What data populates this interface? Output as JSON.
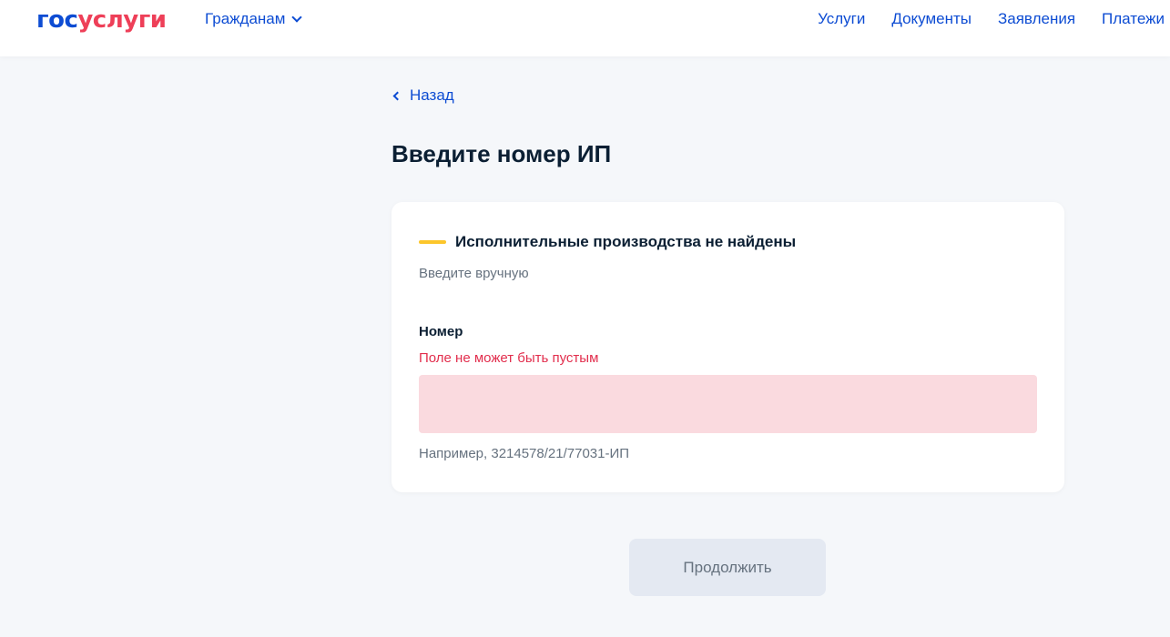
{
  "header": {
    "logo": {
      "part1": "гос",
      "part2": "услуги"
    },
    "audience_menu": "Гражданам",
    "nav": [
      "Услуги",
      "Документы",
      "Заявления",
      "Платежи"
    ]
  },
  "back_link": "Назад",
  "page_title": "Введите номер ИП",
  "card": {
    "alert_title": "Исполнительные производства не найдены",
    "alert_subtitle": "Введите вручную",
    "field": {
      "label": "Номер",
      "error": "Поле не может быть пустым",
      "value": "",
      "hint": "Например, 3214578/21/77031-ИП"
    }
  },
  "continue_button": "Продолжить",
  "colors": {
    "brand_blue": "#0d4cd3",
    "brand_red": "#ee3f58",
    "warning_yellow": "#fcc62b",
    "error_red": "#e22e4d",
    "error_field_bg": "#fadadf",
    "disabled_button_bg": "#e4e9f2"
  }
}
